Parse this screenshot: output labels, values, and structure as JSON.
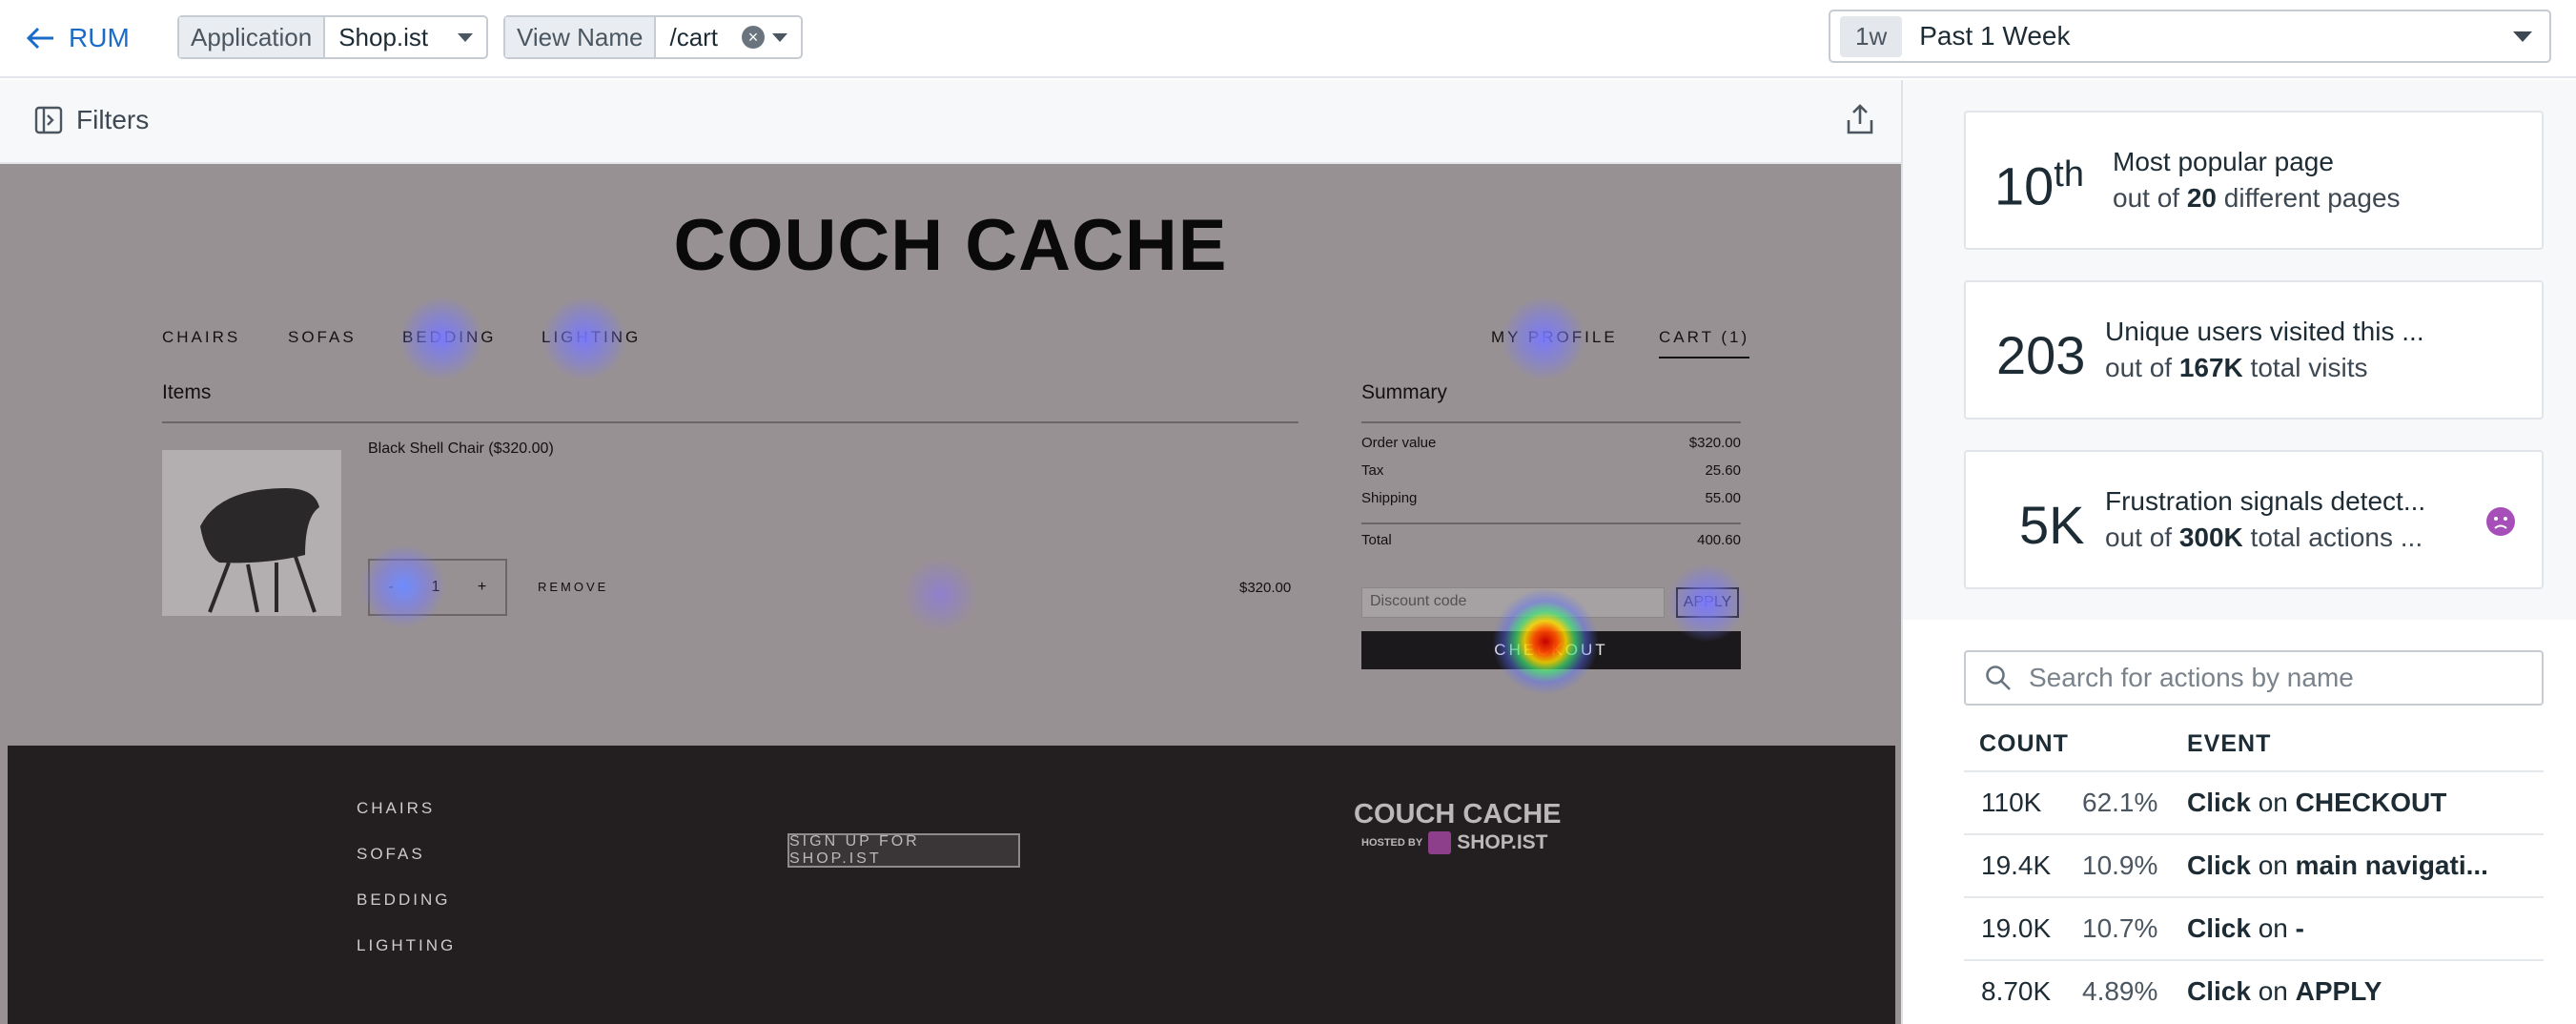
{
  "topbar": {
    "back_label": "RUM",
    "application": {
      "key": "Application",
      "value": "Shop.ist"
    },
    "view_name": {
      "key": "View Name",
      "value": "/cart"
    },
    "time": {
      "badge": "1w",
      "label": "Past 1 Week"
    }
  },
  "filterbar": {
    "filters_label": "Filters"
  },
  "page": {
    "logo": "COUCH CACHE",
    "nav": {
      "chairs": "CHAIRS",
      "sofas": "SOFAS",
      "bedding": "BEDDING",
      "lighting": "LIGHTING",
      "profile": "MY PROFILE",
      "cart": "CART (1)"
    },
    "items_heading": "Items",
    "product_name": "Black Shell Chair",
    "product_price": "($320.00)",
    "qty_minus": "-",
    "qty_value": "1",
    "qty_plus": "+",
    "remove": "REMOVE",
    "line_price": "$320.00",
    "summary_heading": "Summary",
    "summary": [
      {
        "label": "Order value",
        "value": "$320.00"
      },
      {
        "label": "Tax",
        "value": "25.60"
      },
      {
        "label": "Shipping",
        "value": "55.00"
      }
    ],
    "total": {
      "label": "Total",
      "value": "400.60"
    },
    "discount_placeholder": "Discount code",
    "apply": "APPLY",
    "checkout": "CHECKOUT",
    "footer": {
      "links": [
        "CHAIRS",
        "SOFAS",
        "BEDDING",
        "LIGHTING"
      ],
      "signup": "SIGN UP FOR SHOP.IST",
      "logo": "COUCH CACHE",
      "hosted_by": "HOSTED BY",
      "brand": "SHOP.IST"
    }
  },
  "panel": {
    "card1": {
      "value": "10",
      "suffix": "th",
      "line1": "Most popular page",
      "pre": "out of ",
      "bold": "20",
      "post": " different pages"
    },
    "card2": {
      "value": "203",
      "line1": "Unique users visited this ...",
      "pre": "out of ",
      "bold": "167K",
      "post": " total visits"
    },
    "card3": {
      "value": "5K",
      "line1": "Frustration signals detect...",
      "pre": "out of ",
      "bold": "300K",
      "post": " total actions ..."
    },
    "search_placeholder": "Search for actions by name",
    "col_count": "COUNT",
    "col_event": "EVENT",
    "rows": [
      {
        "count": "110K",
        "pct": "62.1%",
        "action": "Click",
        "on": "on",
        "target": "CHECKOUT"
      },
      {
        "count": "19.4K",
        "pct": "10.9%",
        "action": "Click",
        "on": "on",
        "target": "main navigati..."
      },
      {
        "count": "19.0K",
        "pct": "10.7%",
        "action": "Click",
        "on": "on",
        "target": "-"
      },
      {
        "count": "8.70K",
        "pct": "4.89%",
        "action": "Click",
        "on": "on",
        "target": "APPLY"
      }
    ]
  },
  "colors": {
    "accent": "#1b6cc9",
    "frustration": "#a74fb8",
    "heatmap_overlay": "#989193"
  }
}
